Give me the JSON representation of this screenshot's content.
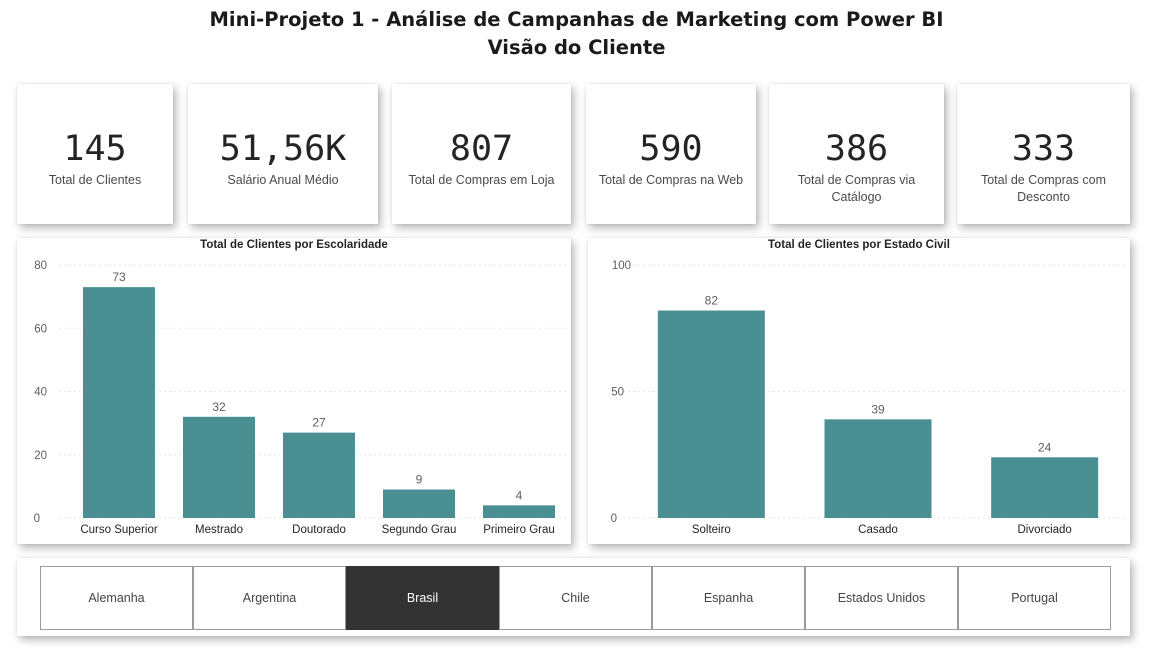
{
  "title": {
    "line1": "Mini-Projeto 1 - Análise de Campanhas de Marketing com Power BI",
    "line2": "Visão do Cliente"
  },
  "kpis": [
    {
      "value": "145",
      "label": "Total de Clientes"
    },
    {
      "value": "51,56K",
      "label": "Salário Anual Médio"
    },
    {
      "value": "807",
      "label": "Total de Compras em Loja"
    },
    {
      "value": "590",
      "label": "Total de Compras na Web"
    },
    {
      "value": "386",
      "label": "Total de Compras via Catálogo"
    },
    {
      "value": "333",
      "label": "Total de Compras com Desconto"
    }
  ],
  "chart_data": [
    {
      "type": "bar",
      "title": "Total de Clientes por Escolaridade",
      "categories": [
        "Curso Superior",
        "Mestrado",
        "Doutorado",
        "Segundo Grau",
        "Primeiro Grau"
      ],
      "values": [
        73,
        32,
        27,
        9,
        4
      ],
      "yticks": [
        0,
        20,
        40,
        60,
        80
      ],
      "ylim": [
        0,
        80
      ],
      "xlabel": "",
      "ylabel": "",
      "bar_color": "#4A8F92",
      "grid": true
    },
    {
      "type": "bar",
      "title": "Total de Clientes por Estado Civil",
      "categories": [
        "Solteiro",
        "Casado",
        "Divorciado"
      ],
      "values": [
        82,
        39,
        24
      ],
      "yticks": [
        0,
        50,
        100
      ],
      "ylim": [
        0,
        100
      ],
      "xlabel": "",
      "ylabel": "",
      "bar_color": "#4A8F92",
      "grid": true
    }
  ],
  "slicer": {
    "options": [
      "Alemanha",
      "Argentina",
      "Brasil",
      "Chile",
      "Espanha",
      "Estados Unidos",
      "Portugal"
    ],
    "selected": "Brasil"
  }
}
